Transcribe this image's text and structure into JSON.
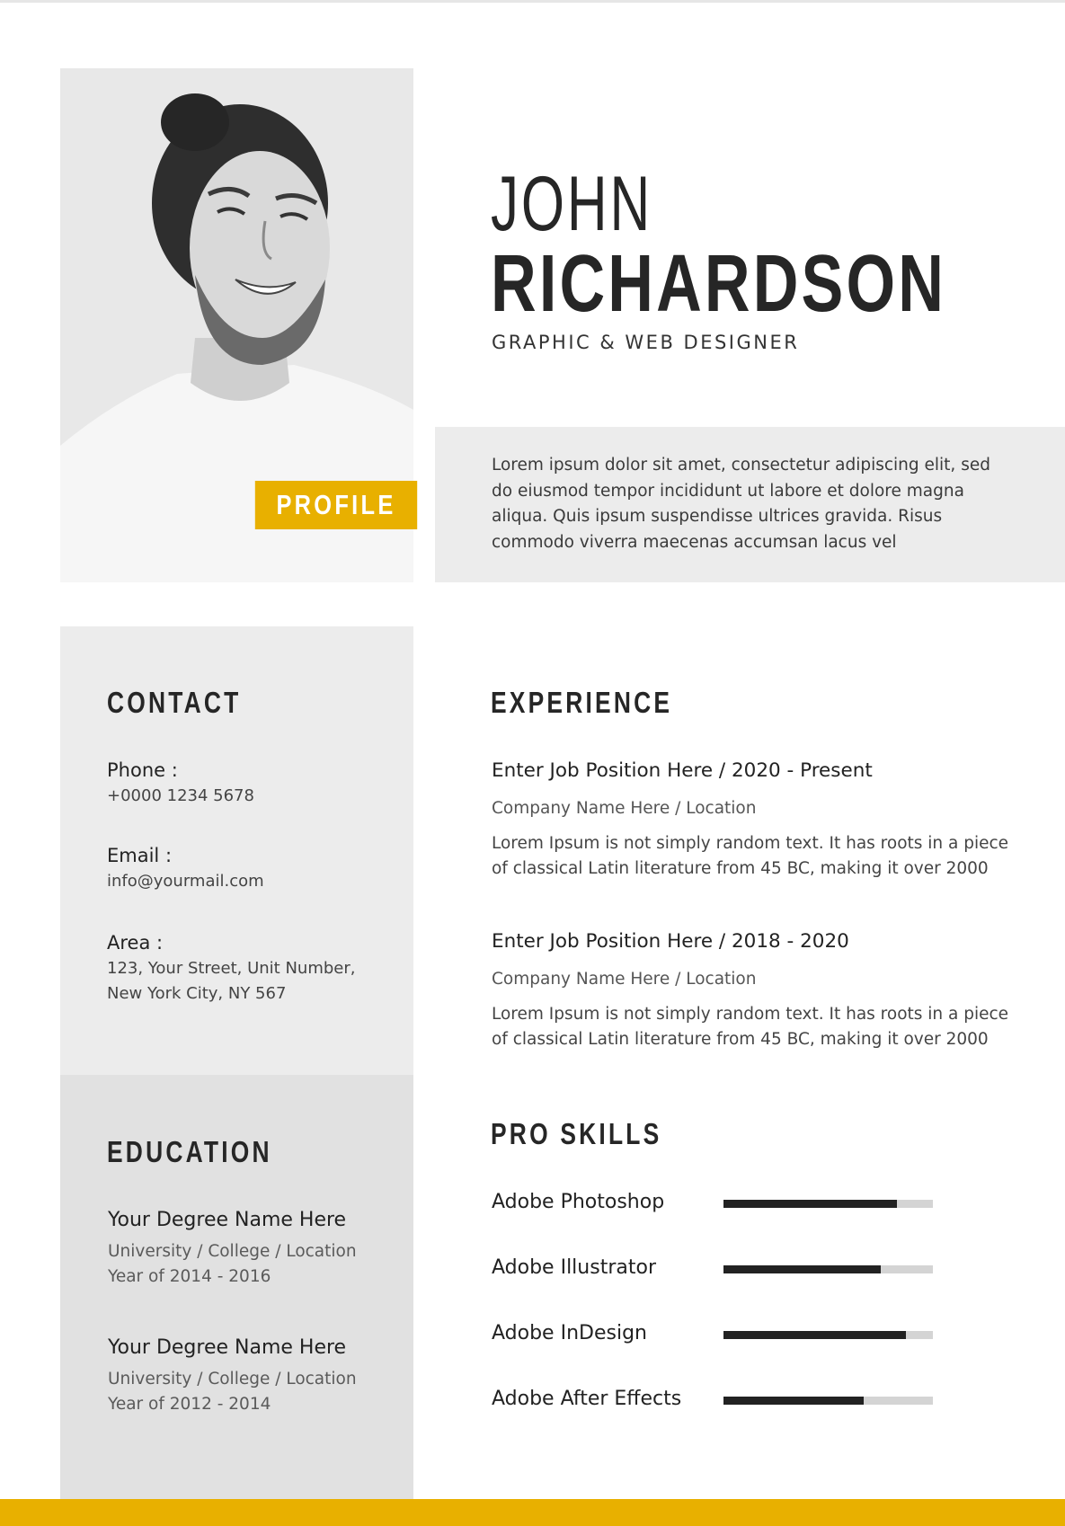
{
  "header": {
    "first_name": "JOHN",
    "last_name": "RICHARDSON",
    "job_title": "GRAPHIC & WEB DESIGNER"
  },
  "profile": {
    "tag": "PROFILE",
    "summary": "Lorem ipsum dolor sit amet, consectetur adipiscing elit, sed do eiusmod tempor incididunt ut labore et dolore magna aliqua. Quis ipsum suspendisse ultrices gravida. Risus commodo viverra maecenas accumsan lacus vel"
  },
  "contact": {
    "heading": "CONTACT",
    "phone_label": "Phone :",
    "phone_value": "+0000 1234 5678",
    "email_label": "Email :",
    "email_value": "info@yourmail.com",
    "area_label": "Area :",
    "area_line1": "123, Your Street, Unit Number,",
    "area_line2": "New York City, NY 567"
  },
  "education": {
    "heading": "EDUCATION",
    "items": [
      {
        "degree": "Your Degree Name Here",
        "school": "University / College / Location",
        "years": "Year of 2014 - 2016"
      },
      {
        "degree": "Your Degree Name Here",
        "school": "University / College / Location",
        "years": "Year of 2012 - 2014"
      }
    ]
  },
  "experience": {
    "heading": "EXPERIENCE",
    "items": [
      {
        "title": "Enter Job Position Here / 2020 - Present",
        "company": "Company Name Here / Location",
        "desc_line1": "Lorem Ipsum is not simply random text. It has roots in a piece",
        "desc_line2": "of classical Latin literature from 45 BC, making it over 2000"
      },
      {
        "title": "Enter Job Position Here / 2018 - 2020",
        "company": "Company Name Here / Location",
        "desc_line1": "Lorem Ipsum is not simply random text. It has roots in a piece",
        "desc_line2": "of classical Latin literature from 45 BC, making it over 2000"
      }
    ]
  },
  "skills": {
    "heading": "PRO SKILLS",
    "items": [
      {
        "name": "Adobe Photoshop",
        "level": 0.83
      },
      {
        "name": "Adobe Illustrator",
        "level": 0.75
      },
      {
        "name": "Adobe InDesign",
        "level": 0.87
      },
      {
        "name": "Adobe After Effects",
        "level": 0.67
      }
    ]
  },
  "colors": {
    "accent": "#e8b000",
    "panel_light": "#ececec",
    "panel_dark": "#e1e1e1",
    "text_dark": "#262626"
  }
}
